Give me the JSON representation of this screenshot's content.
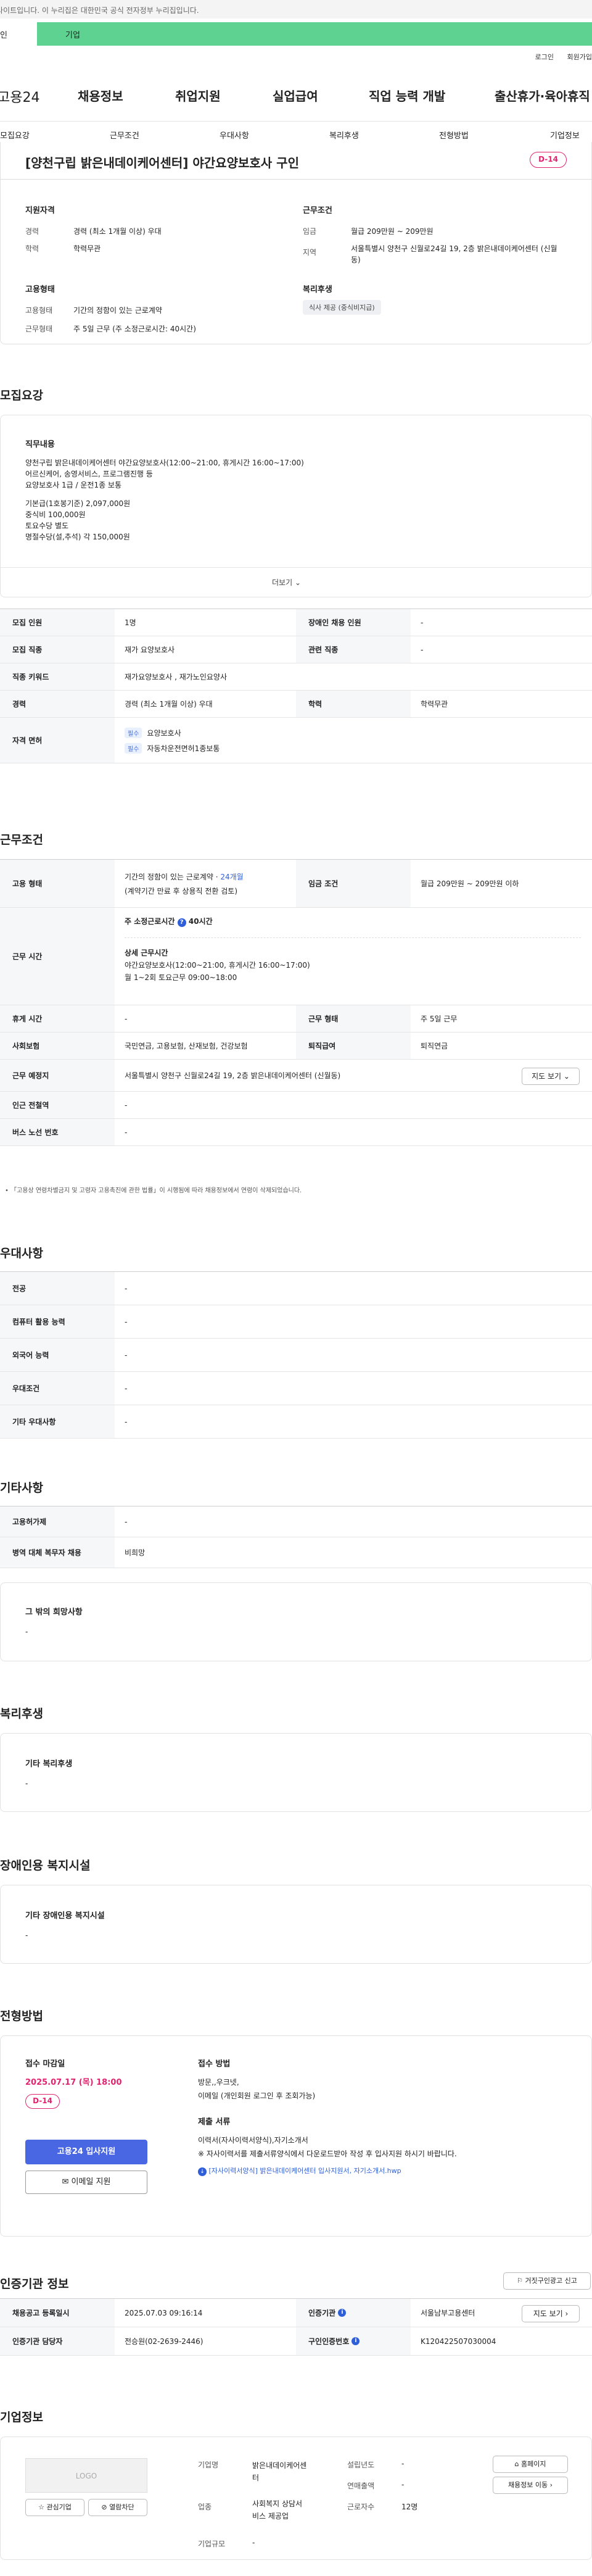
{
  "banner": {
    "text": "사이트입니다. 이 누리집은 대한민국 공식 전자정부 누리집입니다."
  },
  "site_tabs": {
    "left": "인",
    "right": "기업"
  },
  "utility": {
    "login": "로그인",
    "signup": "회원가입"
  },
  "gnb": {
    "logo": "고용24",
    "items": [
      "채용정보",
      "취업지원",
      "실업급여",
      "직업 능력 개발",
      "출산휴가·육아휴직"
    ]
  },
  "subnav": [
    "모집요강",
    "근무조건",
    "우대사항",
    "복리후생",
    "전형방법",
    "기업정보"
  ],
  "summary": {
    "title": "[양천구립 밝은내데이케어센터] 야간요양보호사 구인",
    "dday": "D-14",
    "qual_title": "지원자격",
    "career_k": "경력",
    "career_v": "경력 (최소 1개월 이상) 우대",
    "edu_k": "학력",
    "edu_v": "학력무관",
    "cond_title": "근무조건",
    "wage_k": "임금",
    "wage_v": "월급 209만원 ~ 209만원",
    "area_k": "지역",
    "area_v": "서울특별시 양천구 신월로24길 19, 2층 밝은내데이케어센터 (신월동)",
    "emp_title": "고용형태",
    "emptype_k": "고용형태",
    "emptype_v": "기간의 정함이 있는 근로계약",
    "worktype_k": "근무형태",
    "worktype_v": "주 5일 근무 (주 소정근로시간: 40시간)",
    "welfare_title": "복리후생",
    "welfare_tag": "식사 제공 (중식비지급)"
  },
  "recruit": {
    "heading": "모집요강",
    "duty_title": "직무내용",
    "duty_lines": [
      "양천구립 밝은내데이케어센터 야간요양보호사(12:00~21:00, 휴게시간 16:00~17:00)",
      "어르신케어, 송영서비스, 프로그램진행 등",
      "요양보호사 1급 / 운전1종 보통",
      "",
      "기본급(1호봉기준) 2,097,000원",
      "중식비 100,000원",
      "토요수당 별도",
      "명절수당(설,추석) 각 150,000원"
    ],
    "more": "더보기",
    "rows": {
      "headcount_k": "모집 인원",
      "headcount_v": "1명",
      "disabled_k": "장애인 채용 인원",
      "disabled_v": "-",
      "job_k": "모집 직종",
      "job_v": "재가 요양보호사",
      "related_k": "관련 직종",
      "related_v": "-",
      "keyword_k": "직종 키워드",
      "keyword_v": "재가요양보호사 , 재가노인요양사",
      "career_k": "경력",
      "career_v": "경력 (최소 1개월 이상) 우대",
      "edu_k": "학력",
      "edu_v": "학력무관",
      "license_k": "자격 면허",
      "req_tag": "필수",
      "lic1": "요양보호사",
      "lic2": "자동차운전면허1종보통"
    }
  },
  "work": {
    "heading": "근무조건",
    "emptype_k": "고용 형태",
    "emptype_v": "기간의 정함이 있는 근로계약 · ",
    "emptype_period": "24개월",
    "emptype_sub": "(계약기간 만료 후 상용직 전환 검토)",
    "wage_k": "임금 조건",
    "wage_v": "월급 209만원 ~ 209만원 이하",
    "hours_k": "근무 시간",
    "hours_week_label": "주 소정근로시간",
    "hours_week_v": "40시간",
    "detail_title": "상세 근무시간",
    "detail_1": "야간요양보호사(12:00~21:00, 휴게시간 16:00~17:00)",
    "detail_2": "월 1~2회 토요근무 09:00~18:00",
    "break_k": "휴게 시간",
    "break_v": "-",
    "shift_k": "근무 형태",
    "shift_v": "주 5일 근무",
    "insurance_k": "사회보험",
    "insurance_v": "국민연금, 고용보험, 산재보험, 건강보험",
    "retire_k": "퇴직급여",
    "retire_v": "퇴직연금",
    "place_k": "근무 예정지",
    "place_v": "서울특별시 양천구 신월로24길 19, 2층 밝은내데이케어센터 (신월동)",
    "map_btn": "지도 보기",
    "subway_k": "인근 전철역",
    "subway_v": "-",
    "bus_k": "버스 노선 번호",
    "bus_v": "-",
    "note": "「고용상 연령차별금지 및 고령자 고용촉진에 관한 법률」이 시행됨에 따라 채용정보에서 연령이 삭제되었습니다."
  },
  "pref": {
    "heading": "우대사항",
    "major_k": "전공",
    "major_v": "-",
    "computer_k": "컴퓨터 활용 능력",
    "computer_v": "-",
    "lang_k": "외국어 능력",
    "lang_v": "-",
    "cond_k": "우대조건",
    "cond_v": "-",
    "etc_k": "기타 우대사항",
    "etc_v": "-"
  },
  "etc": {
    "heading": "기타사항",
    "permit_k": "고용허가제",
    "permit_v": "-",
    "military_k": "병역 대체 복무자 채용",
    "military_v": "비희망",
    "wish_title": "그 밖의 희망사항",
    "wish_v": "-"
  },
  "welfare": {
    "heading": "복리후생",
    "title": "기타 복리후생",
    "v": "-"
  },
  "disab": {
    "heading": "장애인용 복지시설",
    "title": "기타 장애인용 복지시설",
    "v": "-"
  },
  "process": {
    "heading": "전형방법",
    "deadline_title": "접수 마감일",
    "deadline_v": "2025.07.17 (목) 18:00",
    "dday": "D-14",
    "apply_btn": "고용24 입사지원",
    "email_btn": "이메일 지원",
    "method_title": "접수 방법",
    "method_1": "방문,,우크넷,",
    "method_2": "이메일 (개인회원 로그인 후 조회가능)",
    "docs_title": "제출 서류",
    "docs_1": "이력서(자사이력서양식),자기소개서",
    "docs_2": "※ 자사이력서를 제출서류양식에서 다운로드받아 작성 후 입사지원 하시기 바랍니다.",
    "file_link": "[자사이력서양식] 밝은내데이케어센터 입사지원서, 자기소개서.hwp"
  },
  "cert": {
    "heading": "인증기관 정보",
    "report_btn": "거짓구인광고 신고",
    "reg_k": "채용공고 등록일시",
    "reg_v": "2025.07.03 09:16:14",
    "agency_k": "인증기관",
    "agency_v": "서울남부고용센터",
    "map_btn": "지도 보기",
    "manager_k": "인증기관 담당자",
    "manager_v": "전승원(02-2639-2446)",
    "no_k": "구인인증번호",
    "no_v": "K120422507030004"
  },
  "company": {
    "heading": "기업정보",
    "logo": "LOGO",
    "fav_btn": "관심기업",
    "block_btn": "열람차단",
    "name_k": "기업명",
    "name_v_1": "밝은내데이케어센",
    "name_v_2": "터",
    "industry_k": "업종",
    "industry_v_1": "사회복지 상담서",
    "industry_v_2": "비스 제공업",
    "size_k": "기업규모",
    "size_v": "-",
    "founded_k": "설립년도",
    "founded_v": "-",
    "sales_k": "연매출액",
    "sales_v": "-",
    "employees_k": "근로자수",
    "employees_v": "12명",
    "homepage_btn": "홈페이지",
    "jobs_btn": "채용정보 이동"
  }
}
